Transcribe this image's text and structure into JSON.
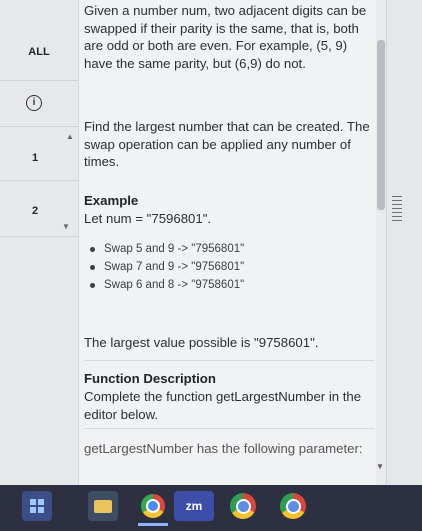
{
  "sidebar": {
    "items": [
      {
        "label": "ALL"
      },
      {
        "label": "1"
      },
      {
        "label": "2"
      }
    ]
  },
  "problem": {
    "p1": "Given a number num, two adjacent digits can be swapped if their parity is the same, that is, both are odd or both are even. For example, (5, 9) have the same parity, but (6,9) do not.",
    "p2": "Find the largest number that can be created. The swap operation can be applied any number of times.",
    "example_heading": "Example",
    "example_line": "Let num = \"7596801\".",
    "steps": [
      "Swap 5 and 9 -> \"7956801\"",
      "Swap 7 and 9 -> \"9756801\"",
      "Swap 6 and 8 -> \"9758601\""
    ],
    "result": "The largest value possible is \"9758601\".",
    "func_heading": "Function Description",
    "func_text": "Complete the function getLargestNumber in the editor below.",
    "param_text": "getLargestNumber has the following parameter:"
  },
  "taskbar": {
    "zoom_label": "zm"
  },
  "icons": [
    "windows-icon",
    "file-explorer-icon",
    "chrome-icon",
    "zoom-icon",
    "chrome-profile-icon",
    "chrome-profile-icon-2"
  ]
}
